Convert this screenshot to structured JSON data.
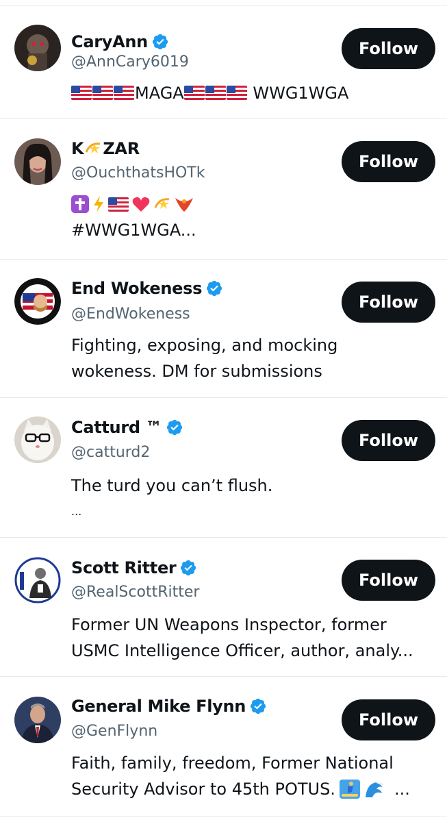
{
  "accounts": [
    {
      "name": "CaryAnn",
      "handle": "@AnnCary6019",
      "verified": true,
      "bio_lines": [
        "MAGA",
        "WWG1WGA"
      ],
      "follow_label": "Follow"
    },
    {
      "name_left": "K",
      "name_right": "ZAR",
      "handle": "@OuchthatsHOTk",
      "verified": false,
      "bio_lines": [
        "#WWG1WGA..."
      ],
      "follow_label": "Follow"
    },
    {
      "name": "End Wokeness",
      "handle": "@EndWokeness",
      "verified": true,
      "bio_lines": [
        "Fighting, exposing, and mocking",
        "wokeness. DM for submissions"
      ],
      "follow_label": "Follow"
    },
    {
      "name": "Catturd ™",
      "handle": "@catturd2",
      "verified": true,
      "bio_lines": [
        "The turd you can’t flush.",
        "..."
      ],
      "follow_label": "Follow"
    },
    {
      "name": "Scott Ritter",
      "handle": "@RealScottRitter",
      "verified": true,
      "bio_lines": [
        "Former UN Weapons Inspector, former",
        "USMC Intelligence Officer, author, analy..."
      ],
      "follow_label": "Follow"
    },
    {
      "name": "General Mike Flynn",
      "handle": "@GenFlynn",
      "verified": true,
      "bio_lines": [
        "Faith, family, freedom, Former National",
        "Security Advisor to 45th POTUS.",
        "..."
      ],
      "follow_label": "Follow"
    }
  ],
  "colors": {
    "verified_badge": "#1d9bf0",
    "follow_button_bg": "#0f1419",
    "handle_gray": "#536471",
    "divider": "#e7e9ea"
  },
  "icons": [
    "verified-badge-icon",
    "us-flag-emoji",
    "cross-emoji",
    "lightning-emoji",
    "heart-emoji",
    "dizzy-emoji",
    "phoenix-emoji",
    "surfer-emoji",
    "wave-emoji"
  ]
}
